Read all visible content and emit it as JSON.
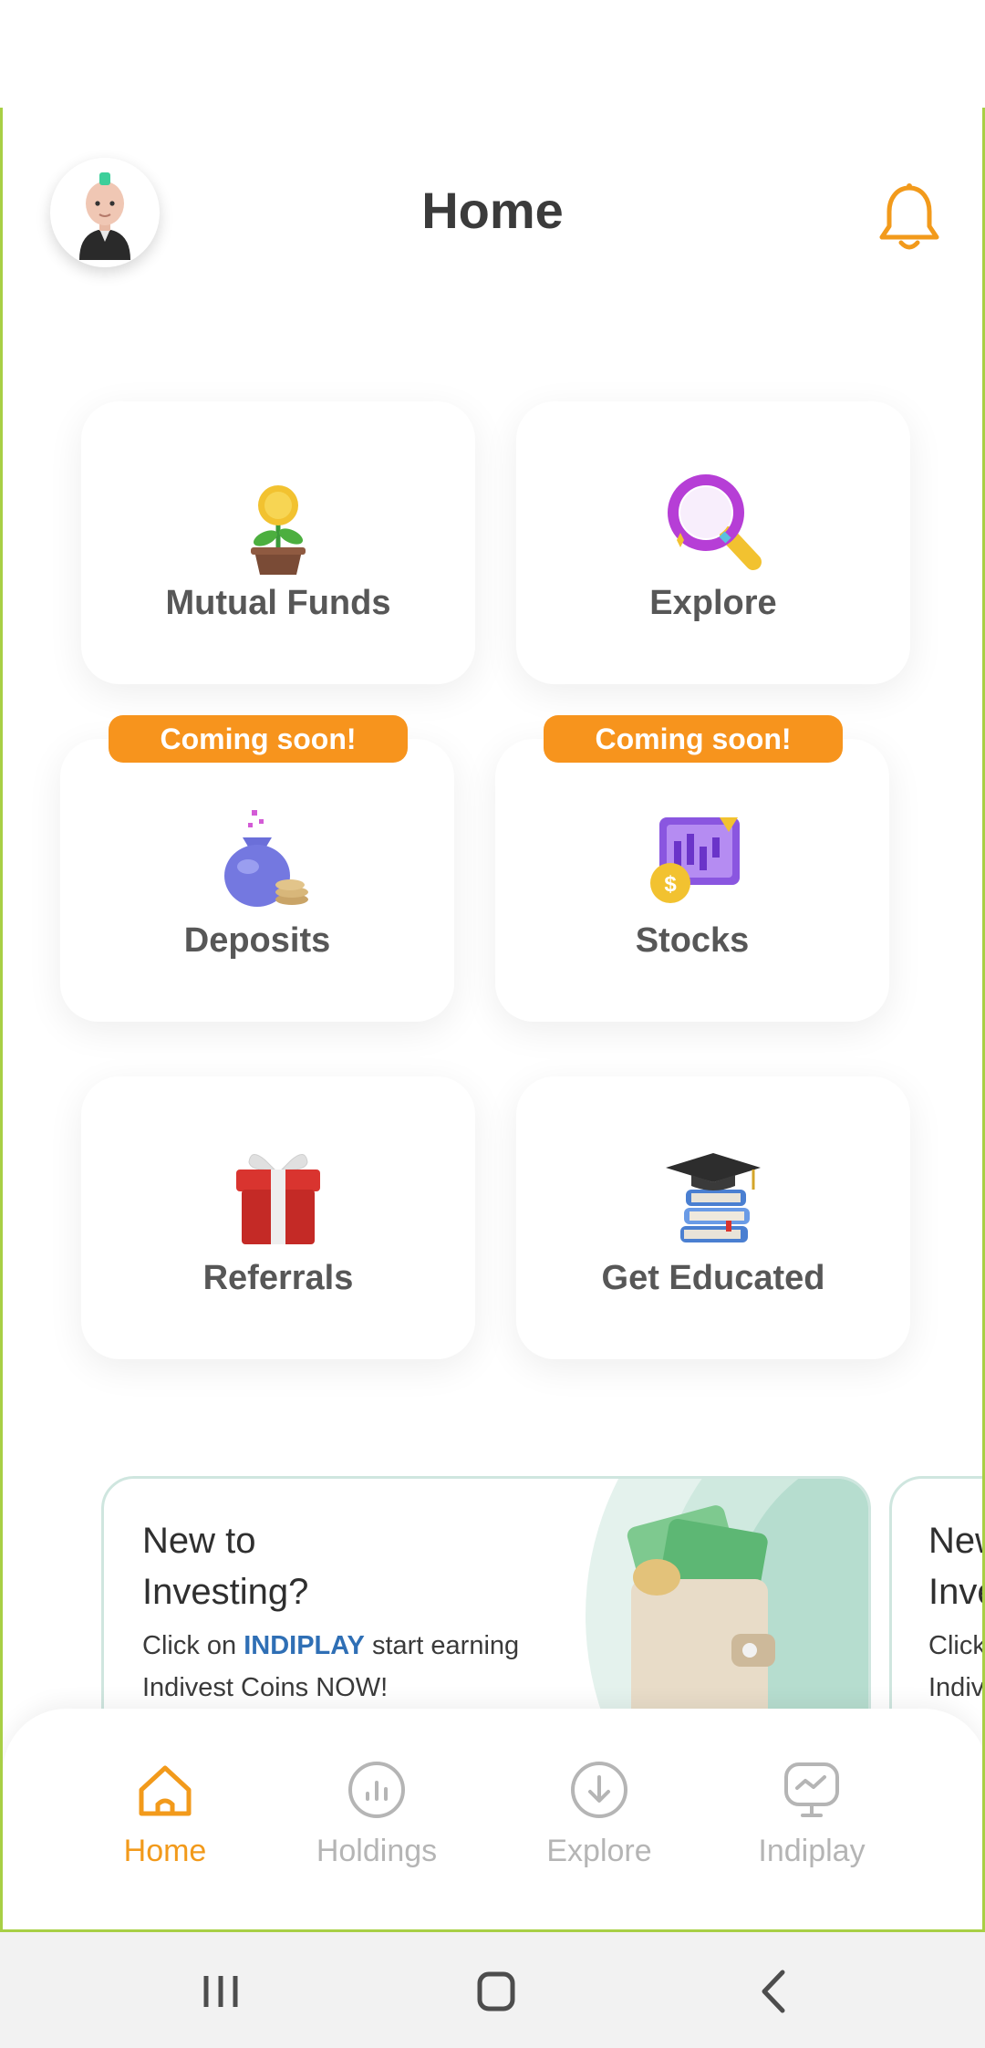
{
  "header": {
    "title": "Home"
  },
  "tiles": [
    {
      "label": "Mutual Funds",
      "icon": "plant-coin-icon"
    },
    {
      "label": "Explore",
      "icon": "magnifier-icon"
    },
    {
      "label": "Deposits",
      "icon": "money-bag-icon",
      "badge": "Coming soon!"
    },
    {
      "label": "Stocks",
      "icon": "stock-chart-icon",
      "badge": "Coming soon!"
    },
    {
      "label": "Referrals",
      "icon": "gift-icon"
    },
    {
      "label": "Get Educated",
      "icon": "books-cap-icon"
    }
  ],
  "banner": {
    "title": "New to Investing?",
    "text_before": "Click on ",
    "highlight": "INDIPLAY",
    "text_after": " start earning Indivest Coins NOW!"
  },
  "banner_next": {
    "title_line1": "New",
    "title_line2": "Inve",
    "text_line1": "Click c",
    "text_line2": "Indive"
  },
  "tabs": [
    {
      "label": "Home",
      "icon": "home-icon",
      "active": true
    },
    {
      "label": "Holdings",
      "icon": "holdings-icon",
      "active": false
    },
    {
      "label": "Explore",
      "icon": "explore-icon",
      "active": false
    },
    {
      "label": "Indiplay",
      "icon": "indiplay-icon",
      "active": false
    }
  ],
  "colors": {
    "accent": "#f7941d",
    "frame": "#a8cf45",
    "text_dark": "#3b3b3b",
    "tab_inactive": "#b5b5b5"
  }
}
